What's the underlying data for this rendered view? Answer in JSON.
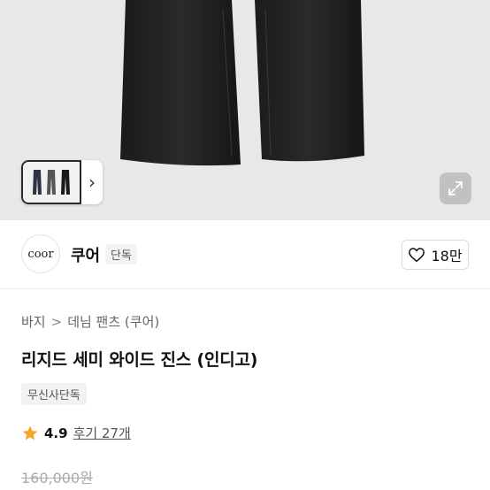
{
  "gallery": {
    "thumbnail_next_glyph": "›",
    "zoom_icon": "expand-icon"
  },
  "brand": {
    "logo_text": "coor",
    "name": "쿠어",
    "badge": "단독",
    "likes": "18만"
  },
  "breadcrumb": {
    "category": "바지",
    "separator": ">",
    "subcategory": "데님 팬츠 (쿠어)"
  },
  "product": {
    "title": "리지드 세미 와이드 진스 (인디고)",
    "exclusive_tag": "무신사단독",
    "rating": "4.9",
    "reviews": "후기 27개",
    "original_price": "160,000원"
  },
  "colors": {
    "star": "#f5a623",
    "hero_bg": "#e8e8e8",
    "denim": "#1f1f1f"
  }
}
